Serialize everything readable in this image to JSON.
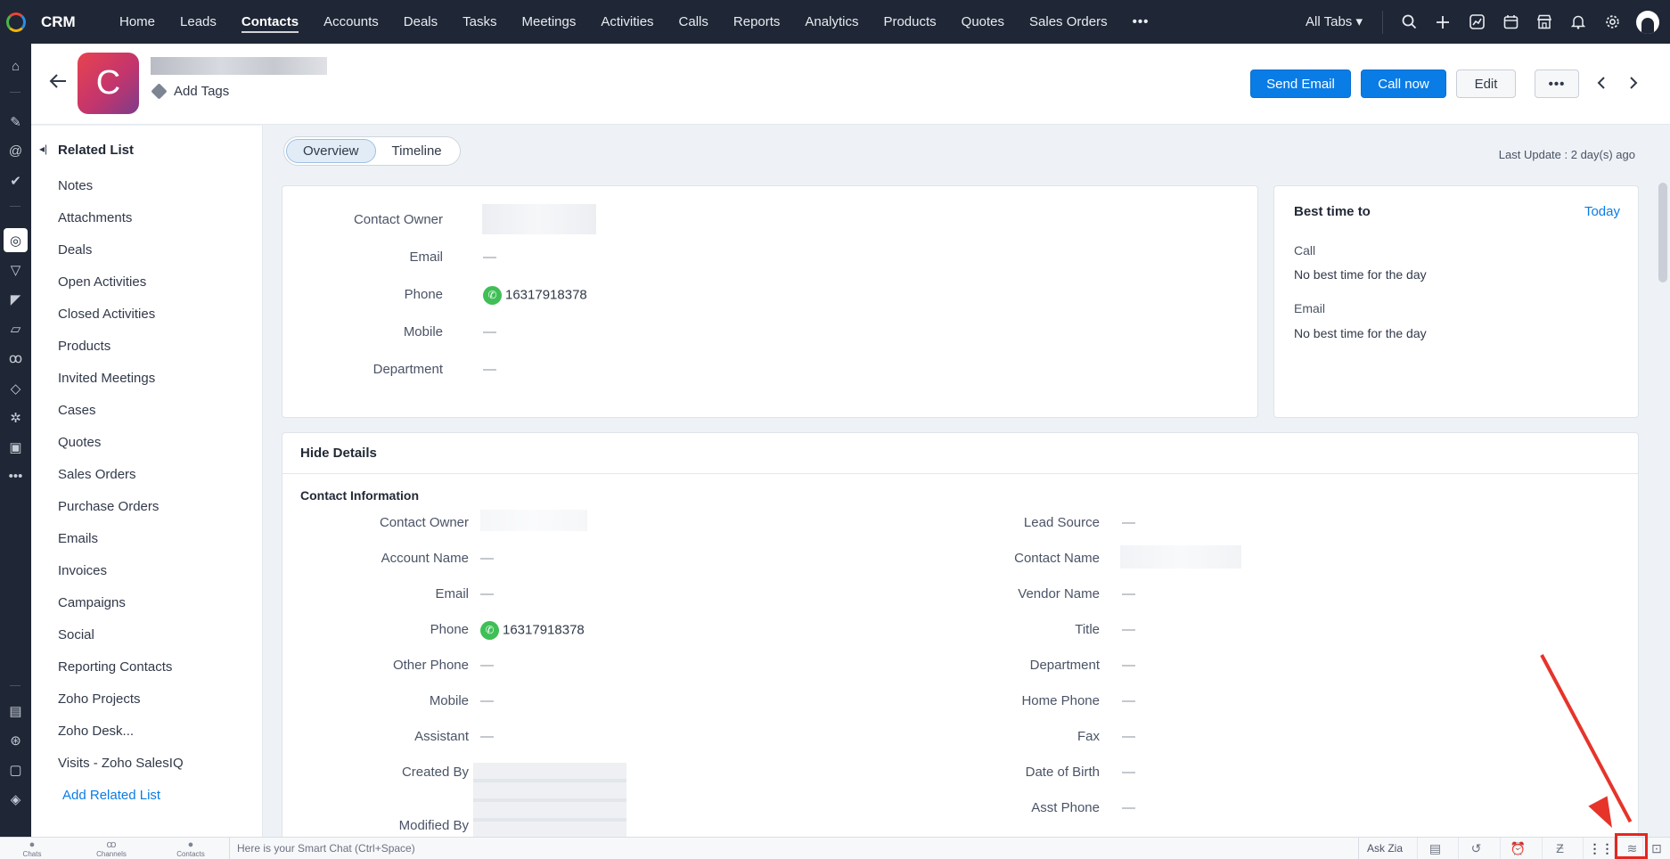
{
  "app": {
    "name": "CRM"
  },
  "nav": {
    "tabs": [
      "Home",
      "Leads",
      "Contacts",
      "Accounts",
      "Deals",
      "Tasks",
      "Meetings",
      "Activities",
      "Calls",
      "Reports",
      "Analytics",
      "Products",
      "Quotes",
      "Sales Orders"
    ],
    "active_tab": "Contacts",
    "more": "•••",
    "all_tabs": "All Tabs ▾"
  },
  "record": {
    "initial": "C",
    "add_tags": "Add Tags",
    "buttons": {
      "send_email": "Send Email",
      "call_now": "Call now",
      "edit": "Edit",
      "more": "•••"
    }
  },
  "related_list": {
    "title": "Related List",
    "items": [
      "Notes",
      "Attachments",
      "Deals",
      "Open Activities",
      "Closed Activities",
      "Products",
      "Invited Meetings",
      "Cases",
      "Quotes",
      "Sales Orders",
      "Purchase Orders",
      "Emails",
      "Invoices",
      "Campaigns",
      "Social",
      "Reporting Contacts",
      "Zoho Projects",
      "Zoho Desk...",
      "Visits - Zoho SalesIQ"
    ],
    "add_link": "Add Related List"
  },
  "view_toggle": {
    "overview": "Overview",
    "timeline": "Timeline"
  },
  "last_update": "Last Update : 2 day(s) ago",
  "summary": {
    "fields": [
      {
        "label": "Contact Owner",
        "value": ""
      },
      {
        "label": "Email",
        "value": "—"
      },
      {
        "label": "Phone",
        "value": "16317918378"
      },
      {
        "label": "Mobile",
        "value": "—"
      },
      {
        "label": "Department",
        "value": "—"
      }
    ]
  },
  "best_time": {
    "title": "Best time to",
    "today": "Today",
    "call_label": "Call",
    "call_value": "No best time for the day",
    "email_label": "Email",
    "email_value": "No best time for the day"
  },
  "details": {
    "hide_label": "Hide Details",
    "section_title": "Contact Information",
    "left": [
      {
        "label": "Contact Owner",
        "value": ""
      },
      {
        "label": "Account Name",
        "value": "—"
      },
      {
        "label": "Email",
        "value": "—"
      },
      {
        "label": "Phone",
        "value": "16317918378"
      },
      {
        "label": "Other Phone",
        "value": "—"
      },
      {
        "label": "Mobile",
        "value": "—"
      },
      {
        "label": "Assistant",
        "value": "—"
      },
      {
        "label": "Created By",
        "value": ""
      },
      {
        "label": "Modified By",
        "value": ""
      }
    ],
    "right": [
      {
        "label": "Lead Source",
        "value": "—"
      },
      {
        "label": "Contact Name",
        "value": ""
      },
      {
        "label": "Vendor Name",
        "value": "—"
      },
      {
        "label": "Title",
        "value": "—"
      },
      {
        "label": "Department",
        "value": "—"
      },
      {
        "label": "Home Phone",
        "value": "—"
      },
      {
        "label": "Fax",
        "value": "—"
      },
      {
        "label": "Date of Birth",
        "value": "—"
      },
      {
        "label": "Asst Phone",
        "value": "—"
      }
    ]
  },
  "bottom_bar": {
    "chats": "Chats",
    "channels": "Channels",
    "contacts": "Contacts",
    "smart_chat_placeholder": "Here is your Smart Chat (Ctrl+Space)",
    "ask_zia": "Ask Zia"
  },
  "colors": {
    "nav_bg": "#1f2635",
    "accent": "#0a7ce6",
    "annotation": "#e6261f"
  }
}
